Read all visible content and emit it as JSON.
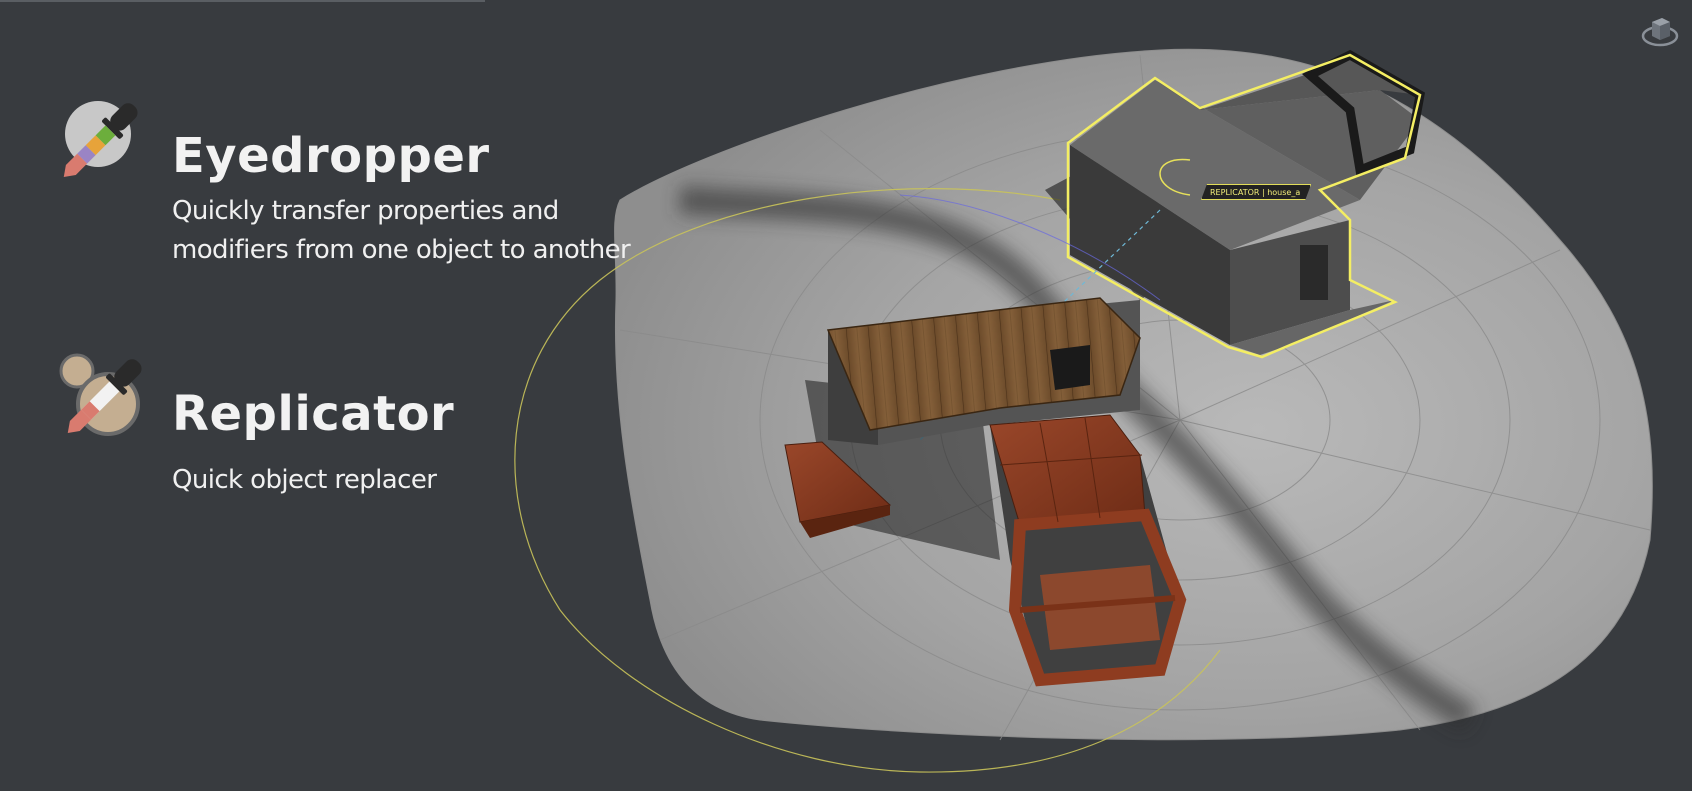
{
  "features": [
    {
      "title": "Eyedropper",
      "description_line1": "Quickly transfer properties and",
      "description_line2": "modifiers from one object to another",
      "icon": "eyedropper-icon"
    },
    {
      "title": "Replicator",
      "description_line1": "Quick object replacer",
      "icon": "replicator-icon"
    }
  ],
  "viewport": {
    "object_tag": "REPLICATOR | house_a",
    "navigation_icon": "orbit-cube-icon"
  },
  "colors": {
    "background": "#383b3f",
    "selection_outline": "#f4ee63",
    "wood": "#7a5530",
    "brick_red": "#8c3d22",
    "ground": "#a8a8a8"
  }
}
